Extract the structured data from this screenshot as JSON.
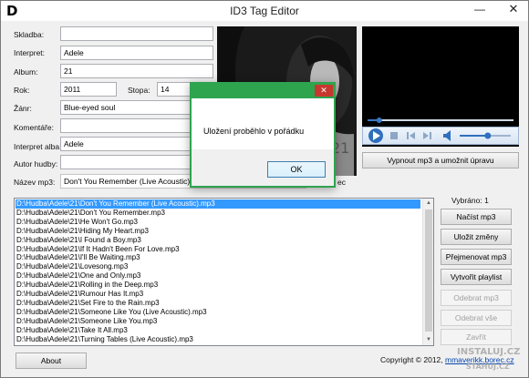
{
  "window": {
    "title": "ID3 Tag Editor",
    "icon_letter": "D",
    "minimize_glyph": "—",
    "maximize_glyph": "☐",
    "close_glyph": "✕"
  },
  "fields": {
    "skladba": {
      "label": "Skladba:",
      "value": ""
    },
    "interpret": {
      "label": "Interpret:",
      "value": "Adele"
    },
    "album": {
      "label": "Album:",
      "value": "21"
    },
    "rok": {
      "label": "Rok:",
      "value": "2011"
    },
    "stopa": {
      "label": "Stopa:",
      "value": "14"
    },
    "zanr": {
      "label": "Žánr:",
      "value": "Blue-eyed soul"
    },
    "komentare": {
      "label": "Komentáře:",
      "value": ""
    },
    "interpret_alba": {
      "label": "Interpret alba:",
      "value": "Adele"
    },
    "autor_hudby": {
      "label": "Autor hudby:",
      "value": ""
    },
    "nazev_mp3": {
      "label": "Název mp3:",
      "value": "Don't You Remember (Live Acoustic).mp3",
      "trailing": "ec"
    }
  },
  "art": {
    "caption": "21"
  },
  "player": {
    "seek_fraction": 0.08,
    "volume_fraction": 0.55
  },
  "buttons": {
    "vypnout": "Vypnout mp3 a umožnit úpravu",
    "nacist": "Načíst mp3",
    "ulozit": "Uložit změny",
    "prejmenovat": "Přejmenovat mp3",
    "vytvorit": "Vytvořit playlist",
    "odebrat": "Odebrat mp3",
    "odebrat_vse": "Odebrat vše",
    "zavrit": "Zavřít",
    "about": "About"
  },
  "vybrano": "Vybráno: 1",
  "files": [
    "D:\\Hudba\\Adele\\21\\Don't You Remember (Live Acoustic).mp3",
    "D:\\Hudba\\Adele\\21\\Don't You Remember.mp3",
    "D:\\Hudba\\Adele\\21\\He Won't Go.mp3",
    "D:\\Hudba\\Adele\\21\\Hiding My Heart.mp3",
    "D:\\Hudba\\Adele\\21\\I Found a Boy.mp3",
    "D:\\Hudba\\Adele\\21\\If It Hadn't Been For Love.mp3",
    "D:\\Hudba\\Adele\\21\\I'll Be Waiting.mp3",
    "D:\\Hudba\\Adele\\21\\Lovesong.mp3",
    "D:\\Hudba\\Adele\\21\\One and Only.mp3",
    "D:\\Hudba\\Adele\\21\\Rolling in the Deep.mp3",
    "D:\\Hudba\\Adele\\21\\Rumour Has It.mp3",
    "D:\\Hudba\\Adele\\21\\Set Fire to the Rain.mp3",
    "D:\\Hudba\\Adele\\21\\Someone Like You (Live Acoustic).mp3",
    "D:\\Hudba\\Adele\\21\\Someone Like You.mp3",
    "D:\\Hudba\\Adele\\21\\Take It All.mp3",
    "D:\\Hudba\\Adele\\21\\Turning Tables (Live Acoustic).mp3"
  ],
  "selected_index": 0,
  "footer": {
    "copyright": "Copyright © 2012,",
    "link": "mmaverikk.borec.cz"
  },
  "dialog": {
    "message": "Uložení proběhlo v pořádku",
    "ok": "OK",
    "close_glyph": "✕"
  },
  "watermark": {
    "line1": "INSTALUJ.CZ",
    "line2": "STAHUJ.CZ"
  },
  "colors": {
    "selection": "#3399ff",
    "dialog_border": "#2ea44f",
    "close_button": "#c7372f"
  }
}
